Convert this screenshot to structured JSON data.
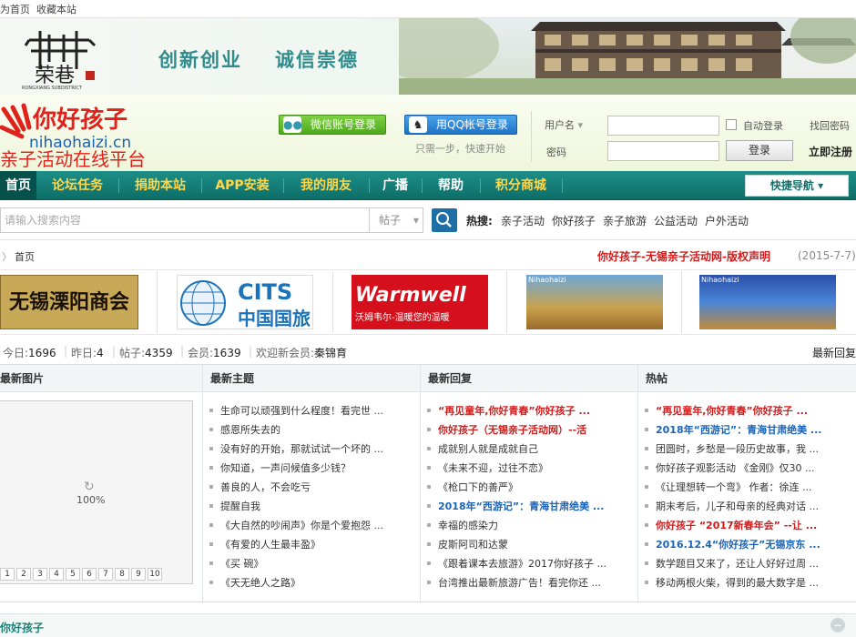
{
  "topbar": {
    "set_home": "为首页",
    "bookmark": "收藏本站"
  },
  "banner": {
    "logo_text": "荣巷",
    "logo_sub": "RONGXIANG SUBDISTRICT",
    "slogan1": "创新创业",
    "slogan2": "诚信崇德"
  },
  "brand": {
    "cn": "你好孩子",
    "domain": "nihaohaizi.cn",
    "tagline": "亲子活动在线平台"
  },
  "login": {
    "wechat": "微信账号登录",
    "qq": "用QQ帐号登录",
    "hint": "只需一步，快速开始",
    "username_label": "用户名",
    "password_label": "密码",
    "remember": "自动登录",
    "forgot": "找回密码",
    "submit": "登录",
    "register": "立即注册"
  },
  "nav": {
    "items": [
      "首页",
      "论坛任务",
      "捐助本站",
      "APP安装",
      "我的朋友",
      "广播",
      "帮助",
      "积分商城"
    ],
    "quick": "快捷导航"
  },
  "search": {
    "placeholder": "请输入搜索内容",
    "scope": "帖子",
    "hot_label": "热搜:",
    "hot": [
      "亲子活动",
      "你好孩子",
      "亲子旅游",
      "公益活动",
      "户外活动"
    ]
  },
  "crumb": {
    "home": "首页",
    "notice": "你好孩子-无锡亲子活动网-版权声明",
    "notice_date": "(2015-7-7)"
  },
  "ads": [
    {
      "line1": "无锡溧阳商会"
    },
    {
      "en": "CITS",
      "cn": "中国国旅"
    },
    {
      "en": "Warmwell",
      "cn": "沃姆韦尔-温暖您的温暖"
    },
    {
      "cap": "Nihaohaizi"
    },
    {
      "cap": "Nihaohaizi"
    }
  ],
  "stats": {
    "today_label": "今日:",
    "today": "1696",
    "yesterday_label": "昨日:",
    "yesterday": "4",
    "posts_label": "帖子:",
    "posts": "4359",
    "members_label": "会员:",
    "members": "1639",
    "welcome_label": "欢迎新会员:",
    "newest": "秦锦育",
    "latest_reply": "最新回复"
  },
  "columns": {
    "images": "最新图片",
    "topics": "最新主题",
    "replies": "最新回复",
    "hot": "热帖"
  },
  "image_loader": {
    "progress": "100%",
    "pages": [
      "1",
      "2",
      "3",
      "4",
      "5",
      "6",
      "7",
      "8",
      "9",
      "10"
    ]
  },
  "topics": [
    "生命可以顽强到什么程度！看完世 ...",
    "感恩所失去的",
    "没有好的开始，那就试试一个坏的 ...",
    "你知道，一声问候值多少钱？",
    "善良的人，不会吃亏",
    "提醒自我",
    "《大自然的吵闹声》你是个爱抱怨 ...",
    "《有爱的人生最丰盈》",
    "《买 碗》",
    "《天无绝人之路》"
  ],
  "replies": [
    {
      "t": "“再见童年,你好青春”你好孩子 ...",
      "s": "red"
    },
    {
      "t": "你好孩子（无锡亲子活动网）--活",
      "s": "red"
    },
    {
      "t": "成就别人就是成就自己",
      "s": ""
    },
    {
      "t": "《未来不迎，过往不恋》",
      "s": ""
    },
    {
      "t": "《枪口下的善严》",
      "s": ""
    },
    {
      "t": "2018年“西游记”：青海甘肃绝美 ...",
      "s": "blue"
    },
    {
      "t": "幸福的感染力",
      "s": ""
    },
    {
      "t": "皮斯阿司和达蒙",
      "s": ""
    },
    {
      "t": "《跟着课本去旅游》2017你好孩子 ...",
      "s": ""
    },
    {
      "t": "台湾推出最新旅游广告！看完你还 ...",
      "s": ""
    }
  ],
  "hot": [
    {
      "t": "“再见童年,你好青春”你好孩子 ...",
      "s": "red"
    },
    {
      "t": "2018年“西游记”：青海甘肃绝美 ...",
      "s": "blue"
    },
    {
      "t": "团圆时，乡愁是一段历史故事，我 ...",
      "s": ""
    },
    {
      "t": "你好孩子观影活动 《金刚》仅30 ...",
      "s": ""
    },
    {
      "t": "《让理想转一个弯》 作者：徐连 ...",
      "s": ""
    },
    {
      "t": "期末考后，儿子和母亲的经典对话 ...",
      "s": ""
    },
    {
      "t": "你好孩子 “2017新春年会” --让 ...",
      "s": "red"
    },
    {
      "t": "2016.12.4“你好孩子”无锡京东 ...",
      "s": "blue"
    },
    {
      "t": "数学题目又来了，还让人好好过周 ...",
      "s": ""
    },
    {
      "t": "移动两根火柴，得到的最大数字是 ...",
      "s": ""
    }
  ],
  "footer": {
    "title": "你好孩子"
  }
}
